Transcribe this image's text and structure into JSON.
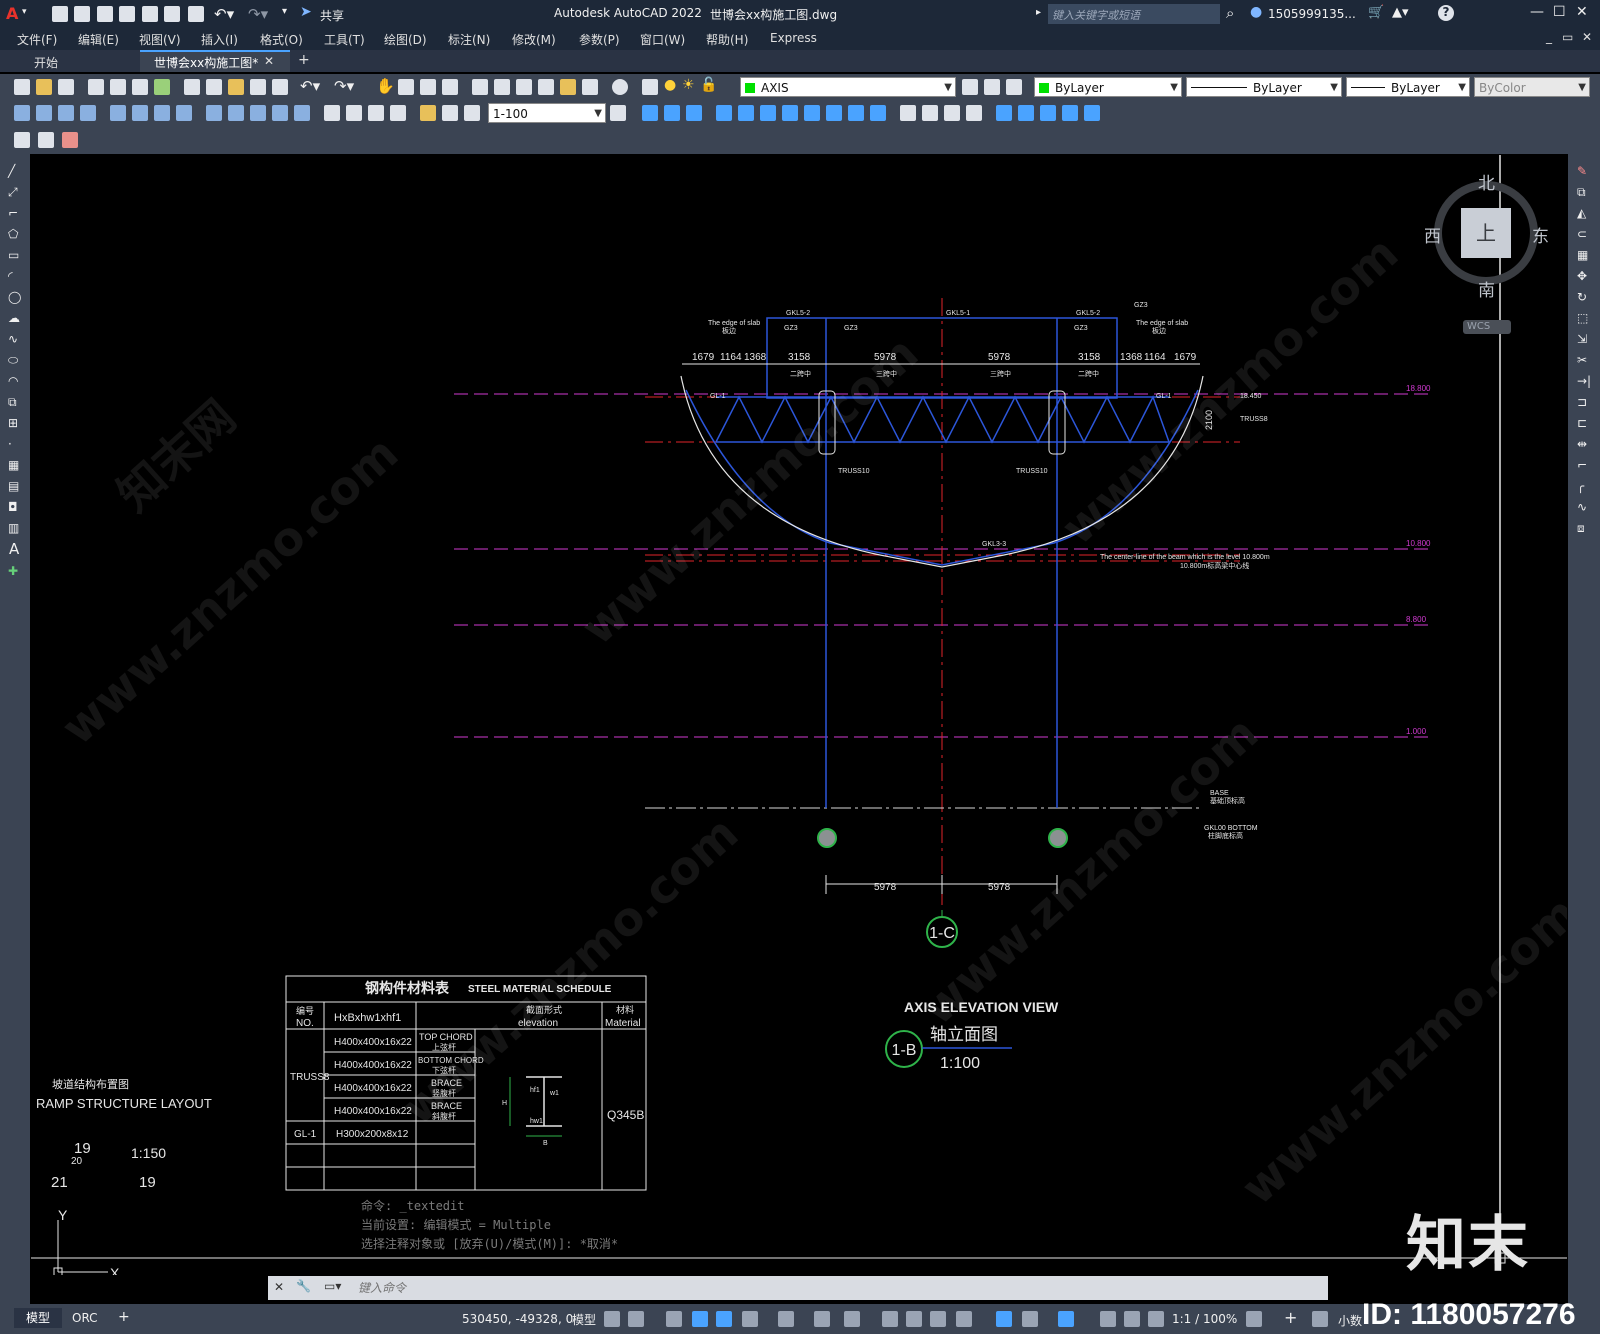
{
  "app": {
    "title": "Autodesk AutoCAD 2022",
    "filename": "世博会xx构施工图.dwg",
    "share_label": "共享",
    "search_placeholder": "键入关键字或短语",
    "user": "1505999135...",
    "help": "?"
  },
  "menu": [
    "文件(F)",
    "编辑(E)",
    "视图(V)",
    "插入(I)",
    "格式(O)",
    "工具(T)",
    "绘图(D)",
    "标注(N)",
    "修改(M)",
    "参数(P)",
    "窗口(W)",
    "帮助(H)",
    "Express"
  ],
  "tabs": {
    "start": "开始",
    "active": "世博会xx构施工图*",
    "add": "+"
  },
  "toolbar": {
    "layer": "AXIS",
    "color": "ByLayer",
    "linetype": "ByLayer",
    "lineweight": "ByLayer",
    "plotstyle": "ByColor",
    "scale": "1-100"
  },
  "viewcube": {
    "north": "北",
    "south": "南",
    "east": "东",
    "west": "西",
    "top": "上",
    "wcs": "WCS"
  },
  "drawing": {
    "dims_top": [
      "1679",
      "1164",
      "1368",
      "3158",
      "5978",
      "5978",
      "3158",
      "1368",
      "1164",
      "1679"
    ],
    "dims_bottom": [
      "5978",
      "5978"
    ],
    "labels_top": [
      "GKL5-2",
      "GKL5-1",
      "GKL5-2",
      "GZ3",
      "GZ3",
      "GZ3",
      "GZ3",
      "GZ3"
    ],
    "edge_note": "The edge of slab",
    "edge_note_cn": "板边",
    "truss": "TRUSS8",
    "truss10": "TRUSS10",
    "dim_2100": "2100",
    "level_18450": "18.450",
    "gl1": "GL-1",
    "gkl33": "GKL3-3",
    "levels": [
      "18.800",
      "10.800",
      "8.800",
      "1.000"
    ],
    "note1": "The center-line of the beam which is the level 10.800m",
    "note2": "10.800m标高梁中心线",
    "note_base": "BASE",
    "note_base_cn": "基础顶标高",
    "note_col1": "GKL00 BOTTOM",
    "note_col2": "柱脚底标高",
    "sub_labels": [
      "二跨中",
      "三跨中",
      "三跨中",
      "二跨中"
    ],
    "axis_bubble": "1-C",
    "title_en": "AXIS ELEVATION VIEW",
    "title_cn": "轴立面图",
    "title_bubble": "1-B",
    "title_scale": "1:100"
  },
  "schedule": {
    "title_cn": "钢构件材料表",
    "title_en": "STEEL MATERIAL SCHEDULE",
    "h_no_cn": "编号",
    "h_no": "NO.",
    "h_size": "HxBxhw1xhf1",
    "h_elev_cn": "截面形式",
    "h_elev": "elevation",
    "h_mat_cn": "材料",
    "h_mat": "Material",
    "group": "TRUSS8",
    "rows": [
      {
        "size": "H400x400x16x22",
        "type": "TOP CHORD",
        "type_cn": "上弦杆"
      },
      {
        "size": "H400x400x16x22",
        "type": "BOTTOM CHORD",
        "type_cn": "下弦杆"
      },
      {
        "size": "H400x400x16x22",
        "type": "BRACE",
        "type_cn": "竖腹杆"
      },
      {
        "size": "H400x400x16x22",
        "type": "BRACE",
        "type_cn": "斜腹杆"
      }
    ],
    "gl1_no": "GL-1",
    "gl1_size": "H300x200x8x12",
    "material": "Q345B",
    "sec_h": "H",
    "sec_b": "B",
    "sec_w1": "w1",
    "sec_hf1": "hf1",
    "sec_hw1": "hw1"
  },
  "ramp": {
    "title_cn": "坡道结构布置图",
    "title_en": "RAMP STRUCTURE LAYOUT",
    "n19a": "19",
    "n20": "20",
    "scale": "1:150",
    "n21": "21",
    "n19b": "19"
  },
  "ucs": {
    "y": "Y",
    "x": "X"
  },
  "command": {
    "history": [
      "命令: _textedit",
      "当前设置: 编辑模式 = Multiple",
      "选择注释对象或 [放弃(U)/模式(M)]: *取消*"
    ],
    "placeholder": "键入命令"
  },
  "status": {
    "model_tab": "模型",
    "layout_tab": "ORC",
    "add_tab": "+",
    "coords": "530450, -49328, 0",
    "model": "模型",
    "scale": "1:1 / 100%",
    "units": "小数"
  },
  "watermark": {
    "brand": "知末",
    "id": "ID: 1180057276",
    "site": "www.znzmo.com",
    "site_cn": "知末网"
  }
}
